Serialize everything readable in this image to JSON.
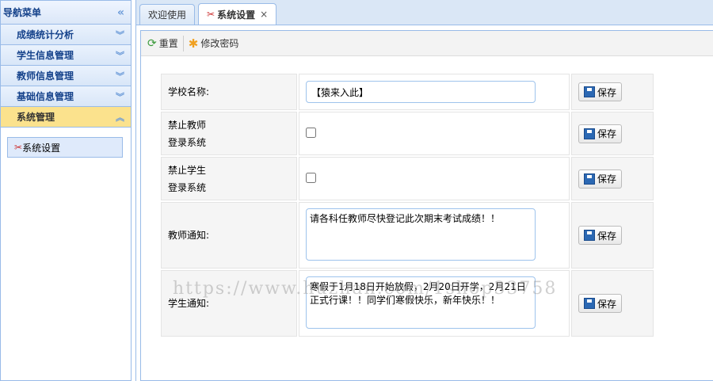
{
  "sidebar": {
    "title": "导航菜单",
    "items": [
      {
        "label": "成绩统计分析"
      },
      {
        "label": "学生信息管理"
      },
      {
        "label": "教师信息管理"
      },
      {
        "label": "基础信息管理"
      },
      {
        "label": "系统管理"
      }
    ],
    "sub_item": "系统设置"
  },
  "tabs": [
    {
      "label": "欢迎使用"
    },
    {
      "label": "系统设置",
      "close": "×"
    }
  ],
  "toolbar": {
    "reset": "重置",
    "change_password": "修改密码"
  },
  "form": {
    "save": "保存",
    "rows": [
      {
        "label": "学校名称:",
        "value": "【猿来入此】"
      },
      {
        "label1": "禁止教师",
        "label2": "登录系统",
        "checked": false
      },
      {
        "label1": "禁止学生",
        "label2": "登录系统",
        "checked": false
      },
      {
        "label": "教师通知:",
        "value": "请各科任教师尽快登记此次期末考试成绩！！"
      },
      {
        "label": "学生通知:",
        "value": "寒假于1月18日开始放假，2月20日开学，2月21日正式行课！！同学们寒假快乐，新年快乐！！"
      }
    ]
  },
  "watermark": "https://www.huzhan.com/1shop33758"
}
